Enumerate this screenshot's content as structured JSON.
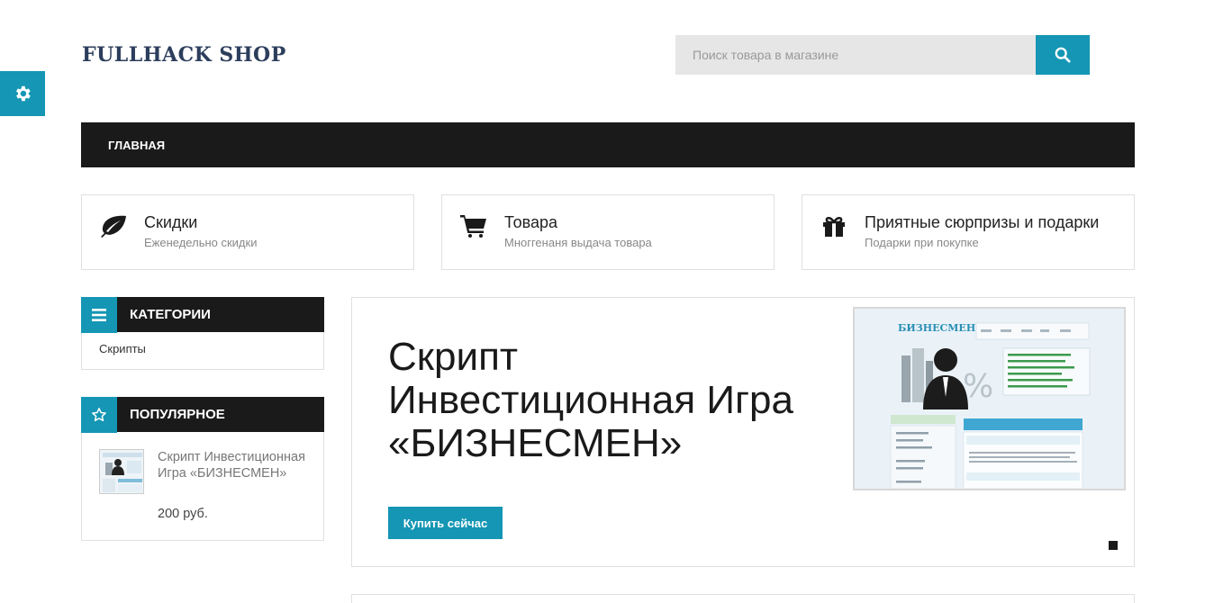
{
  "logo": "FULLHACK SHOP",
  "search": {
    "placeholder": "Поиск товара в магазине"
  },
  "nav": {
    "items": [
      "ГЛАВНАЯ"
    ]
  },
  "features": [
    {
      "icon": "leaf-icon",
      "title": "Скидки",
      "subtitle": "Еженедельно скидки"
    },
    {
      "icon": "cart-icon",
      "title": "Товара",
      "subtitle": "Многгенаня выдача товара"
    },
    {
      "icon": "gift-icon",
      "title": "Приятные сюрпризы и подарки",
      "subtitle": "Подарки при покупке"
    }
  ],
  "categories": {
    "title": "КАТЕГОРИИ",
    "items": [
      "Скрипты"
    ]
  },
  "popular": {
    "title": "ПОПУЛЯРНОЕ",
    "items": [
      {
        "name": "Скрипт Инвестиционная Игра «БИЗНЕСМЕН»",
        "price": "200 руб."
      }
    ]
  },
  "slider": {
    "title": "Скрипт Инвестиционная Игра «БИЗНЕСМЕН»",
    "button": "Купить сейчас",
    "image_logo": "БИЗНЕСМЕН"
  },
  "colors": {
    "accent": "#1496b4",
    "dark": "#1a1a1a"
  }
}
